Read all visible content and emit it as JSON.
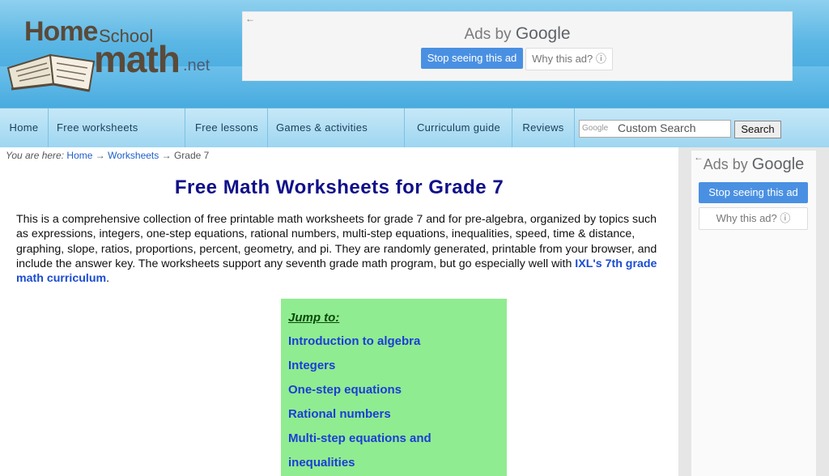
{
  "logo": {
    "home": "Home",
    "school": "School",
    "math": "math",
    "net": ".net"
  },
  "top_ad": {
    "back": "←",
    "ads_by": "Ads by",
    "google": "Google",
    "stop": "Stop seeing this ad",
    "why": "Why this ad? ⓘ"
  },
  "nav": {
    "items": [
      "Home",
      "Free worksheets",
      "Free lessons",
      "Games & activities",
      "Curriculum guide",
      "Reviews"
    ],
    "search_google": "Google",
    "search_placeholder": "Custom Search",
    "search_button": "Search"
  },
  "breadcrumb": {
    "prefix": "You are here:",
    "home": "Home",
    "arrow1": "→",
    "worksheets": "Worksheets",
    "arrow2": "→",
    "current": "Grade 7"
  },
  "page": {
    "title": "Free Math Worksheets for Grade 7",
    "intro_text": "This is a comprehensive collection of free printable math worksheets for grade 7 and for pre-algebra, organized by topics such as expressions, integers, one-step equations, rational numbers, multi-step equations, inequalities, speed, time & distance, graphing, slope, ratios, proportions, percent, geometry, and pi. They are randomly generated, printable from your browser, and include the answer key. The worksheets support any seventh grade math program, but go especially well with ",
    "intro_link": "IXL's 7th grade math curriculum",
    "intro_end": "."
  },
  "jump": {
    "title": "Jump to:",
    "links": [
      "Introduction to algebra",
      "Integers",
      "One-step equations",
      "Rational numbers",
      "Multi-step equations and",
      "inequalities"
    ]
  },
  "side_ad": {
    "back": "←",
    "ads_by": "Ads by",
    "google": "Google",
    "stop": "Stop seeing this ad",
    "why": "Why this ad? ⓘ"
  },
  "colors": {
    "header": "#5ab6e4",
    "title": "#10108a",
    "link": "#1a3ed8",
    "jump_bg": "#90ec90"
  }
}
